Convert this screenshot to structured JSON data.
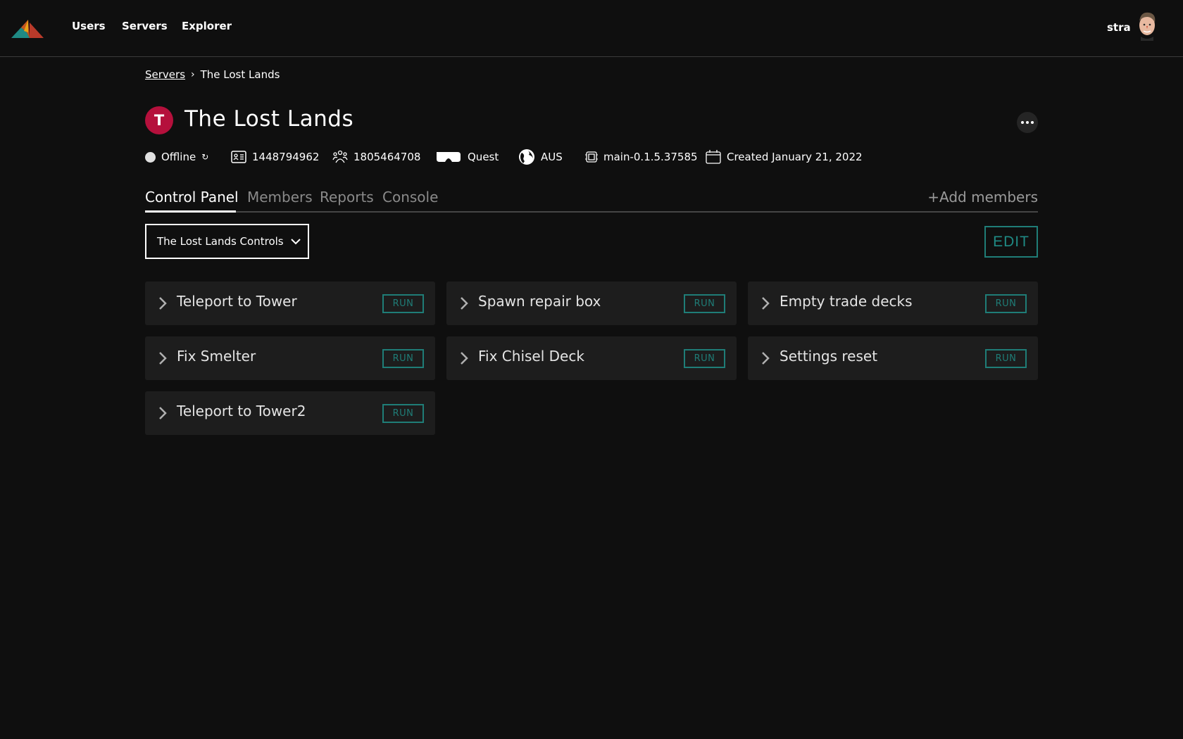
{
  "topbar": {
    "nav": [
      "Users",
      "Servers",
      "Explorer"
    ],
    "user_name": "stra",
    "logo_colors": {
      "teal": "#1f8a84",
      "yellow": "#e8a317",
      "orange": "#c4551f",
      "red": "#b83a2a"
    }
  },
  "breadcrumb": {
    "parent": "Servers",
    "separator": "›",
    "current": "The Lost Lands"
  },
  "server": {
    "icon_letter": "T",
    "icon_color": "#b5103c",
    "title": "The Lost Lands",
    "status": "Offline",
    "refresh_icon": "↻",
    "id": "1448794962",
    "group_id": "1805464708",
    "platform": "Quest",
    "region": "AUS",
    "version": "main-0.1.5.37585",
    "created": "Created January 21, 2022"
  },
  "tabs": [
    {
      "label": "Control Panel",
      "active": true
    },
    {
      "label": "Members",
      "active": false
    },
    {
      "label": "Reports",
      "active": false
    },
    {
      "label": "Console",
      "active": false
    }
  ],
  "add_members_label": "+Add members",
  "controls": {
    "selected": "The Lost Lands Controls",
    "edit_label": "EDIT",
    "run_label": "RUN",
    "accent": "#1f7d77",
    "items": [
      "Teleport to Tower",
      "Spawn repair box",
      "Empty trade decks",
      "Fix Smelter",
      "Fix Chisel Deck",
      "Settings reset",
      "Teleport to Tower2"
    ]
  }
}
